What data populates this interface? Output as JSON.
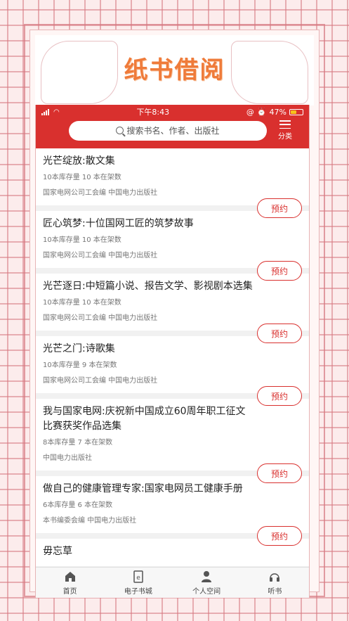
{
  "page": {
    "title": "纸书借阅"
  },
  "status_bar": {
    "time": "下午8:43",
    "battery": "47%",
    "battery_level": 0.47
  },
  "search": {
    "placeholder": "搜索书名、作者、出版社"
  },
  "category": {
    "label": "分类"
  },
  "reserve_label": "预约",
  "books": [
    {
      "title": "光芒绽放:散文集",
      "stock": "10本库存量  10 本在架数",
      "publisher": "国家电网公司工会编  中国电力出版社"
    },
    {
      "title": "匠心筑梦:十位国网工匠的筑梦故事",
      "stock": "10本库存量  10 本在架数",
      "publisher": "国家电网公司工会编  中国电力出版社"
    },
    {
      "title": "光芒逐日:中短篇小说、报告文学、影视剧本选集",
      "stock": "10本库存量  10 本在架数",
      "publisher": "国家电网公司工会编  中国电力出版社"
    },
    {
      "title": "光芒之门:诗歌集",
      "stock": "10本库存量  9 本在架数",
      "publisher": "国家电网公司工会编  中国电力出版社"
    },
    {
      "title": "我与国家电网:庆祝新中国成立60周年职工征文比赛获奖作品选集",
      "stock": "8本库存量  7 本在架数",
      "publisher": " 中国电力出版社"
    },
    {
      "title": "做自己的健康管理专家:国家电网员工健康手册",
      "stock": "6本库存量  6 本在架数",
      "publisher": "本书编委会编  中国电力出版社"
    },
    {
      "title": "毋忘草",
      "stock": "",
      "publisher": ""
    }
  ],
  "tabs": [
    {
      "label": "首页",
      "icon": "home-icon"
    },
    {
      "label": "电子书城",
      "icon": "ebook-icon"
    },
    {
      "label": "个人空间",
      "icon": "person-icon"
    },
    {
      "label": "听书",
      "icon": "audio-icon"
    }
  ],
  "colors": {
    "brand_red": "#d9302e",
    "title_orange": "#ef7b3a"
  }
}
